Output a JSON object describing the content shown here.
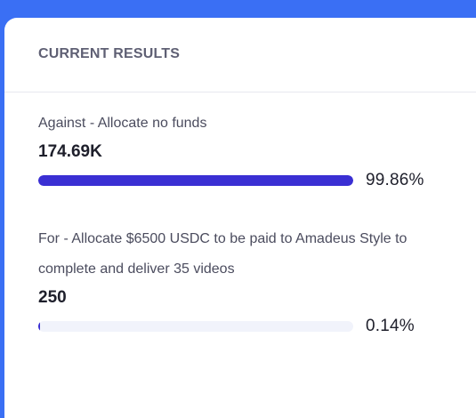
{
  "panel": {
    "title": "CURRENT RESULTS"
  },
  "choices": [
    {
      "label": "Against - Allocate no funds",
      "count": "174.69K",
      "percent_label": "99.86%",
      "fraction": 0.9986
    },
    {
      "label": "For - Allocate $6500 USDC to be paid to Amadeus Style to complete and deliver 35 videos",
      "count": "250",
      "percent_label": "0.14%",
      "fraction": 0.0014
    }
  ],
  "colors": {
    "background": "#3a6ff4",
    "bar_fill": "#3a2fd3",
    "bar_track": "#f1f3fb"
  }
}
